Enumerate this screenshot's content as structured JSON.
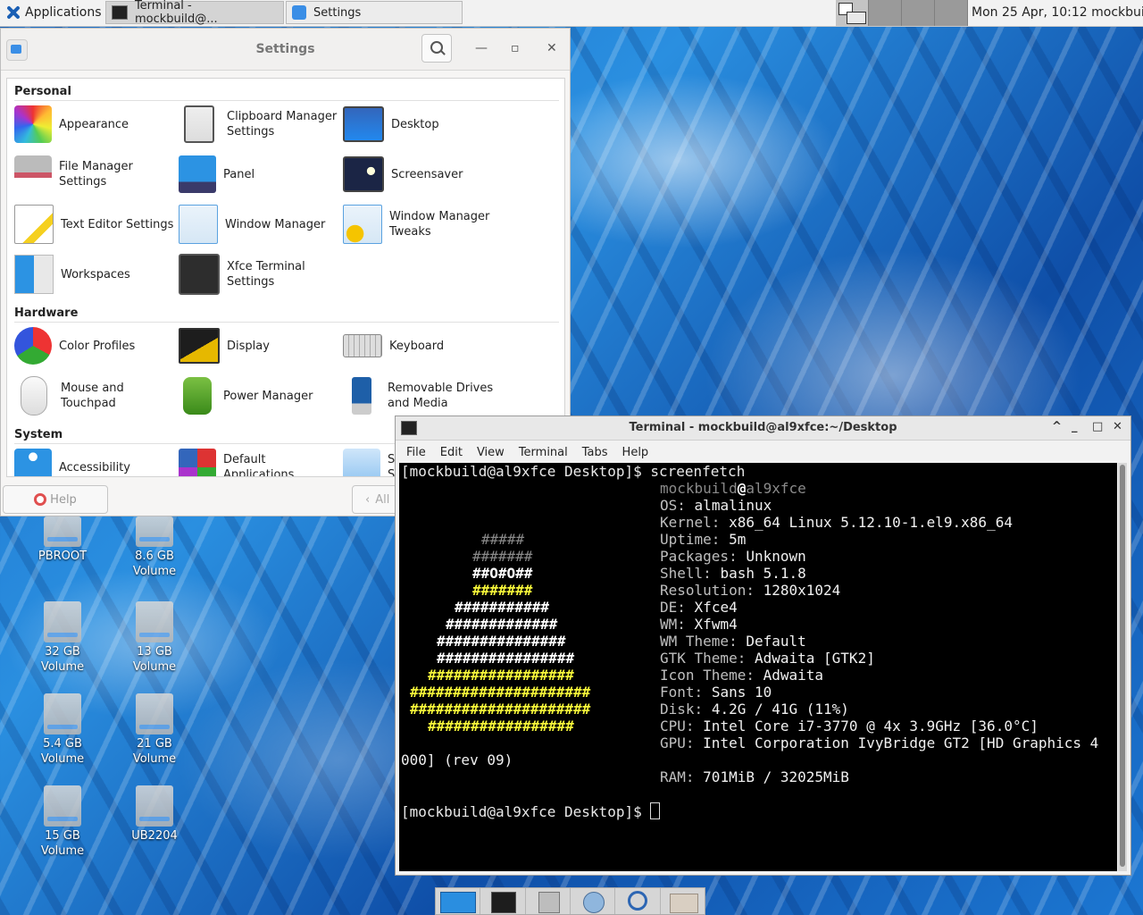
{
  "panel": {
    "apps_label": "Applications",
    "tasks": [
      "Terminal - mockbuild@...",
      "Settings"
    ],
    "clock": "Mon 25 Apr, 10:12 mockbuild"
  },
  "settings": {
    "title": "Settings",
    "sections": {
      "personal": "Personal",
      "hardware": "Hardware",
      "system": "System"
    },
    "items": {
      "appearance": "Appearance",
      "clipboard": "Clipboard Manager Settings",
      "desktop": "Desktop",
      "file_manager": "File Manager Settings",
      "panel": "Panel",
      "screensaver": "Screensaver",
      "text_editor": "Text Editor Settings",
      "window_manager": "Window Manager",
      "wm_tweaks": "Window Manager Tweaks",
      "workspaces": "Workspaces",
      "xfce_terminal": "Xfce Terminal Settings",
      "color_profiles": "Color Profiles",
      "display": "Display",
      "keyboard": "Keyboard",
      "mouse": "Mouse and Touchpad",
      "power": "Power Manager",
      "removable": "Removable Drives and Media",
      "accessibility": "Accessibility",
      "default_apps": "Default Applications",
      "partial_item": "S\nS"
    },
    "help_label": "Help",
    "all_label": "All"
  },
  "desktop_icons": [
    {
      "line1": "PBROOT",
      "line2": ""
    },
    {
      "line1": "8.6 GB",
      "line2": "Volume"
    },
    {
      "line1": "32 GB",
      "line2": "Volume"
    },
    {
      "line1": "13 GB",
      "line2": "Volume"
    },
    {
      "line1": "5.4 GB",
      "line2": "Volume"
    },
    {
      "line1": "21 GB",
      "line2": "Volume"
    },
    {
      "line1": "15 GB",
      "line2": "Volume"
    },
    {
      "line1": "UB2204",
      "line2": ""
    }
  ],
  "terminal": {
    "title": "Terminal - mockbuild@al9xfce:~/Desktop",
    "menu": [
      "File",
      "Edit",
      "View",
      "Terminal",
      "Tabs",
      "Help"
    ],
    "prompt": "[mockbuild@al9xfce Desktop]$ ",
    "command": "screenfetch",
    "user": "mockbuild",
    "at": "@",
    "host": "al9xfce",
    "info": [
      {
        "key": "OS:",
        "value": "almalinux"
      },
      {
        "key": "Kernel:",
        "value": "x86_64 Linux 5.12.10-1.el9.x86_64"
      },
      {
        "key": "Uptime:",
        "value": "5m"
      },
      {
        "key": "Packages:",
        "value": "Unknown"
      },
      {
        "key": "Shell:",
        "value": "bash 5.1.8"
      },
      {
        "key": "Resolution:",
        "value": "1280x1024"
      },
      {
        "key": "DE:",
        "value": "Xfce4"
      },
      {
        "key": "WM:",
        "value": "Xfwm4"
      },
      {
        "key": "WM Theme:",
        "value": "Default"
      },
      {
        "key": "GTK Theme:",
        "value": "Adwaita [GTK2]"
      },
      {
        "key": "Icon Theme:",
        "value": "Adwaita"
      },
      {
        "key": "Font:",
        "value": "Sans 10"
      },
      {
        "key": "Disk:",
        "value": "4.2G / 41G (11%)"
      },
      {
        "key": "CPU:",
        "value": "Intel Core i7-3770 @ 4x 3.9GHz [36.0°C]"
      },
      {
        "key": "GPU:",
        "value": "Intel Corporation IvyBridge GT2 [HD Graphics 4"
      }
    ],
    "wrap": "000] (rev 09)",
    "ram_key": "RAM:",
    "ram_value": "701MiB / 32025MiB",
    "ascii": [
      "#####",
      "#######",
      "##O#O##",
      "#######",
      "###########",
      "#############",
      "###############",
      "################",
      "#################",
      "#####################",
      "#####################",
      "#################"
    ]
  }
}
